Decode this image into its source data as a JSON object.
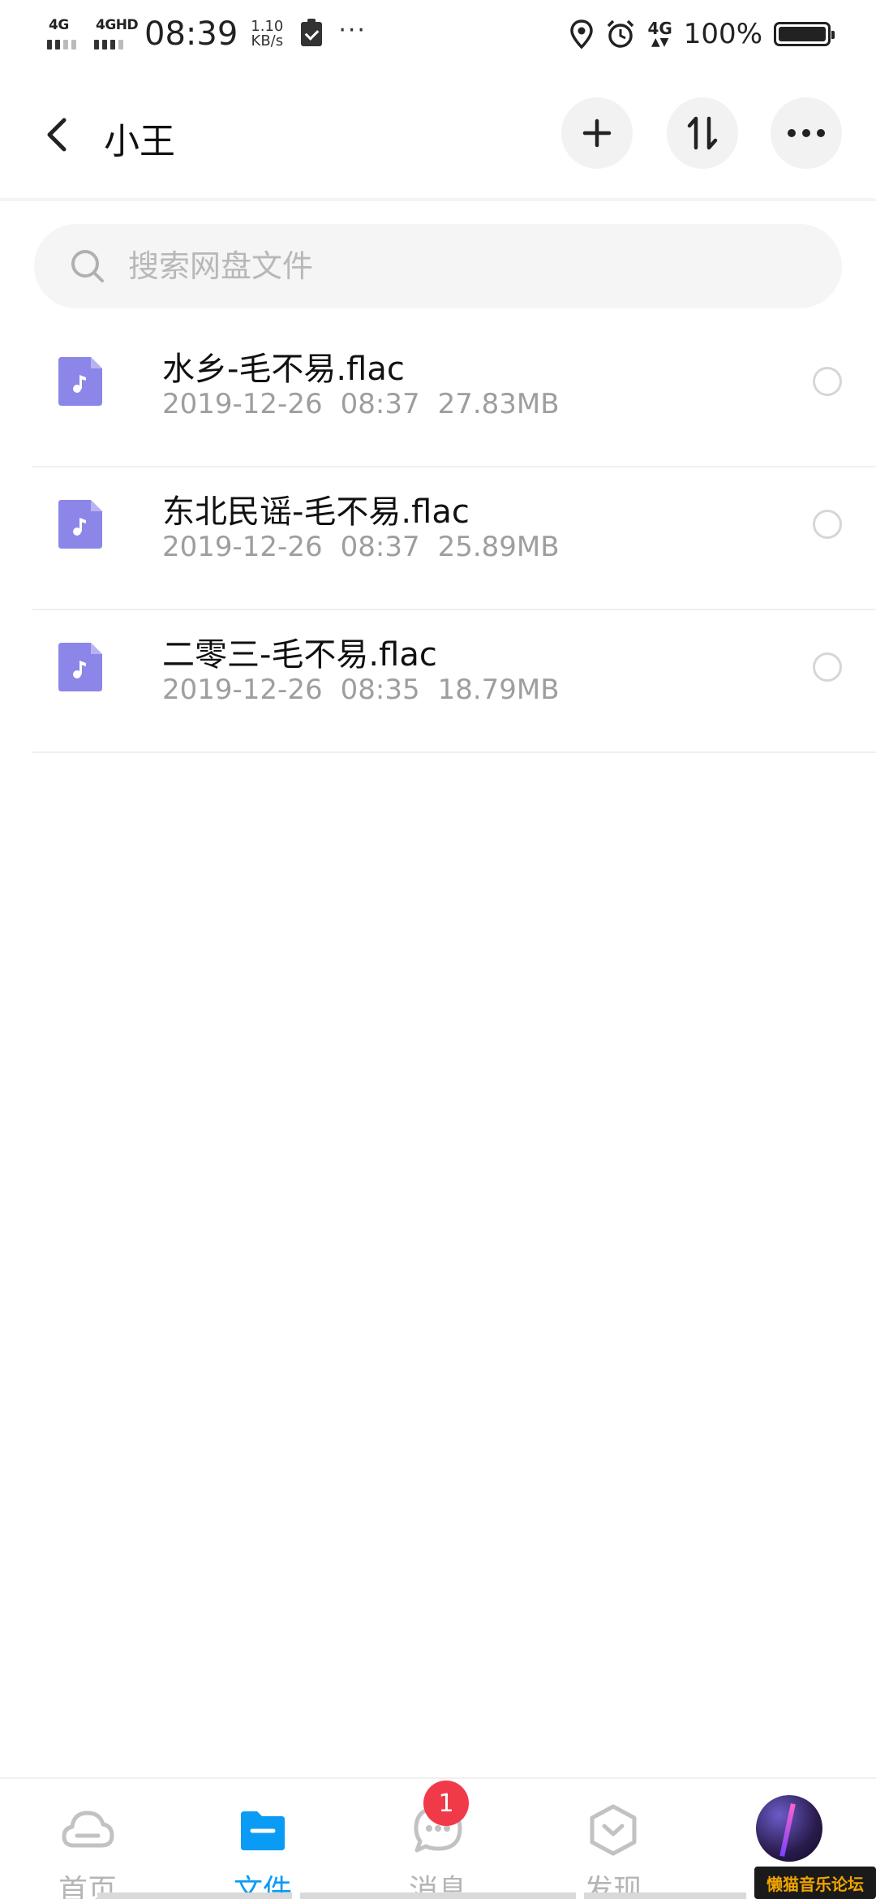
{
  "status_bar": {
    "sim1_net": "4G",
    "sim2_net": "4GHD",
    "time": "08:39",
    "speed_value": "1.10",
    "speed_unit": "KB/s",
    "more": "···",
    "net_right": "4G",
    "battery_pct": "100%"
  },
  "header": {
    "title": "小王"
  },
  "search": {
    "placeholder": "搜索网盘文件"
  },
  "files": [
    {
      "name": "水乡-毛不易.flac",
      "date": "2019-12-26",
      "time": "08:37",
      "size": "27.83MB"
    },
    {
      "name": "东北民谣-毛不易.flac",
      "date": "2019-12-26",
      "time": "08:37",
      "size": "25.89MB"
    },
    {
      "name": "二零三-毛不易.flac",
      "date": "2019-12-26",
      "time": "08:35",
      "size": "18.79MB"
    }
  ],
  "nav": {
    "home": "首页",
    "files": "文件",
    "messages": "消息",
    "messages_badge": "1",
    "discover": "发现"
  },
  "watermark": "懒猫音乐论坛",
  "colors": {
    "accent": "#0a9bf5",
    "music_icon": "#8b86e8",
    "badge": "#f03a4a"
  },
  "icons": {
    "back": "chevron-left-icon",
    "add": "plus-icon",
    "sort": "sort-arrows-icon",
    "more": "more-dots-icon",
    "search": "search-icon",
    "file": "music-file-icon",
    "nav_home": "cloud-icon",
    "nav_files": "folder-icon",
    "nav_messages": "chat-bubble-icon",
    "nav_discover": "hexagon-chevron-icon"
  }
}
